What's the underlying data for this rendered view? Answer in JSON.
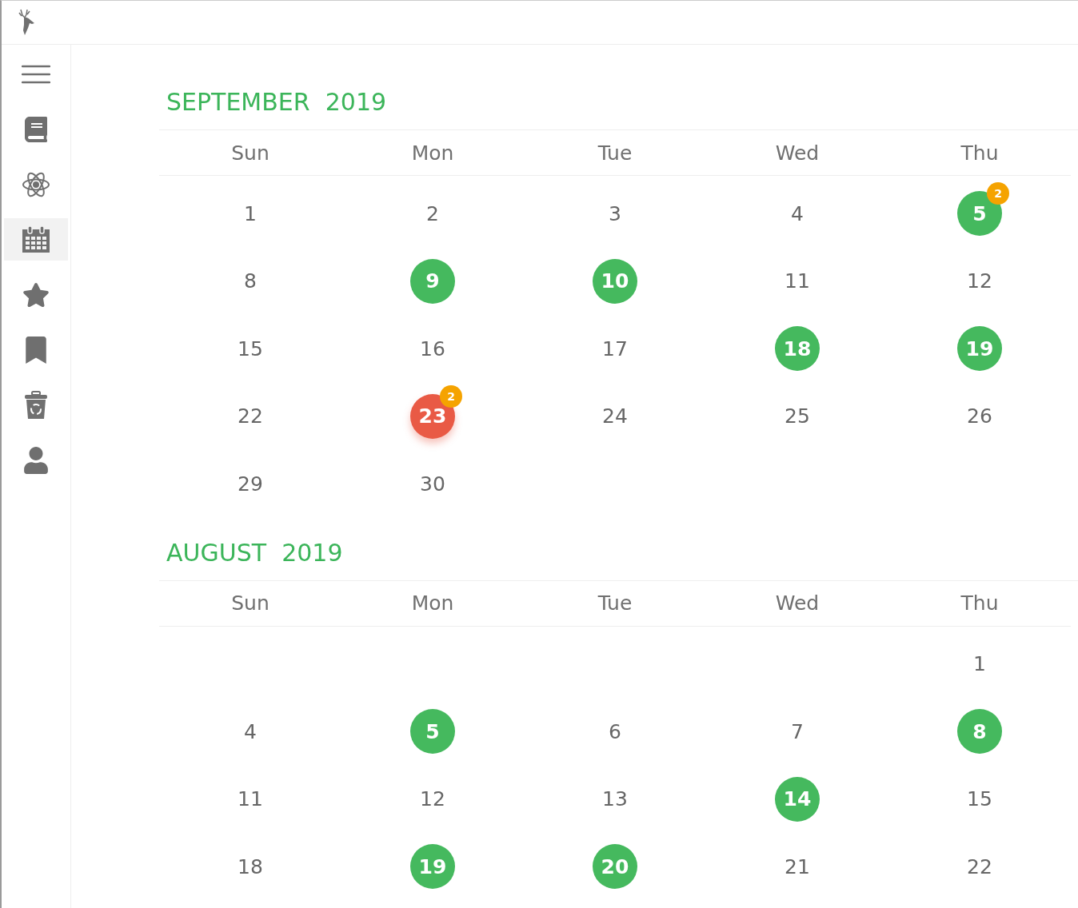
{
  "sidebar": {
    "items": [
      {
        "kind": "menu",
        "selected": false
      },
      {
        "kind": "book",
        "selected": false
      },
      {
        "kind": "atom",
        "selected": false
      },
      {
        "kind": "calendar",
        "selected": true
      },
      {
        "kind": "star",
        "selected": false
      },
      {
        "kind": "bookmark",
        "selected": false
      },
      {
        "kind": "trash",
        "selected": false
      },
      {
        "kind": "user",
        "selected": false
      }
    ]
  },
  "months": [
    {
      "title": "SEPTEMBER  2019",
      "weekdays": [
        "Sun",
        "Mon",
        "Tue",
        "Wed",
        "Thu"
      ],
      "weeks": [
        [
          {
            "day": "1",
            "kind": "plain"
          },
          {
            "day": "2",
            "kind": "plain"
          },
          {
            "day": "3",
            "kind": "plain"
          },
          {
            "day": "4",
            "kind": "plain"
          },
          {
            "day": "5",
            "kind": "event",
            "badge": "2"
          }
        ],
        [
          {
            "day": "8",
            "kind": "plain"
          },
          {
            "day": "9",
            "kind": "event"
          },
          {
            "day": "10",
            "kind": "event"
          },
          {
            "day": "11",
            "kind": "plain"
          },
          {
            "day": "12",
            "kind": "plain"
          }
        ],
        [
          {
            "day": "15",
            "kind": "plain"
          },
          {
            "day": "16",
            "kind": "plain"
          },
          {
            "day": "17",
            "kind": "plain"
          },
          {
            "day": "18",
            "kind": "event"
          },
          {
            "day": "19",
            "kind": "event"
          }
        ],
        [
          {
            "day": "22",
            "kind": "plain"
          },
          {
            "day": "23",
            "kind": "today",
            "badge": "2"
          },
          {
            "day": "24",
            "kind": "plain"
          },
          {
            "day": "25",
            "kind": "plain"
          },
          {
            "day": "26",
            "kind": "plain"
          }
        ],
        [
          {
            "day": "29",
            "kind": "plain"
          },
          {
            "day": "30",
            "kind": "plain"
          },
          {
            "kind": "empty"
          },
          {
            "kind": "empty"
          },
          {
            "kind": "empty"
          }
        ]
      ]
    },
    {
      "title": "AUGUST  2019",
      "weekdays": [
        "Sun",
        "Mon",
        "Tue",
        "Wed",
        "Thu"
      ],
      "weeks": [
        [
          {
            "kind": "empty"
          },
          {
            "kind": "empty"
          },
          {
            "kind": "empty"
          },
          {
            "kind": "empty"
          },
          {
            "day": "1",
            "kind": "plain"
          }
        ],
        [
          {
            "day": "4",
            "kind": "plain"
          },
          {
            "day": "5",
            "kind": "event"
          },
          {
            "day": "6",
            "kind": "plain"
          },
          {
            "day": "7",
            "kind": "plain"
          },
          {
            "day": "8",
            "kind": "event"
          }
        ],
        [
          {
            "day": "11",
            "kind": "plain"
          },
          {
            "day": "12",
            "kind": "plain"
          },
          {
            "day": "13",
            "kind": "plain"
          },
          {
            "day": "14",
            "kind": "event"
          },
          {
            "day": "15",
            "kind": "plain"
          }
        ],
        [
          {
            "day": "18",
            "kind": "plain"
          },
          {
            "day": "19",
            "kind": "event"
          },
          {
            "day": "20",
            "kind": "event"
          },
          {
            "day": "21",
            "kind": "plain"
          },
          {
            "day": "22",
            "kind": "plain"
          }
        ]
      ]
    }
  ]
}
